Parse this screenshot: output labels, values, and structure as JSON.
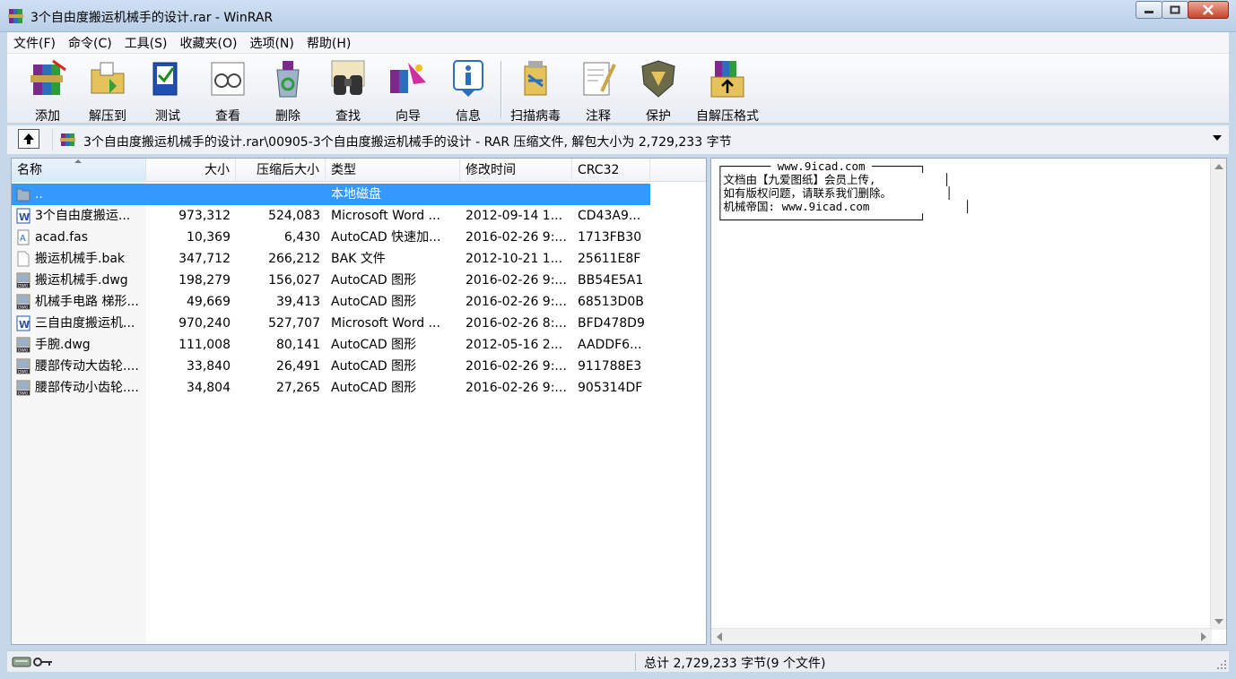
{
  "window": {
    "title": "3个自由度搬运机械手的设计.rar - WinRAR"
  },
  "menu": [
    {
      "label": "文件(F)"
    },
    {
      "label": "命令(C)"
    },
    {
      "label": "工具(S)"
    },
    {
      "label": "收藏夹(O)"
    },
    {
      "label": "选项(N)"
    },
    {
      "label": "帮助(H)"
    }
  ],
  "toolbar": [
    {
      "label": "添加",
      "icon": "add-books-icon"
    },
    {
      "label": "解压到",
      "icon": "extract-folder-icon"
    },
    {
      "label": "测试",
      "icon": "test-check-icon"
    },
    {
      "label": "查看",
      "icon": "view-glasses-icon"
    },
    {
      "label": "删除",
      "icon": "delete-recycle-icon"
    },
    {
      "label": "查找",
      "icon": "find-binoculars-icon"
    },
    {
      "label": "向导",
      "icon": "wizard-icon"
    },
    {
      "label": "信息",
      "icon": "info-icon"
    },
    {
      "label": "扫描病毒",
      "icon": "virus-scan-icon"
    },
    {
      "label": "注释",
      "icon": "comment-pen-icon"
    },
    {
      "label": "保护",
      "icon": "protect-shield-icon"
    },
    {
      "label": "自解压格式",
      "icon": "sfx-box-icon"
    }
  ],
  "address": {
    "path": "3个自由度搬运机械手的设计.rar\\00905-3个自由度搬运机械手的设计 - RAR 压缩文件, 解包大小为 2,729,233 字节"
  },
  "columns": {
    "name": "名称",
    "size": "大小",
    "packed": "压缩后大小",
    "type": "类型",
    "modified": "修改时间",
    "crc": "CRC32"
  },
  "files": [
    {
      "icon": "folder-up-icon",
      "name": "..",
      "size": "",
      "packed": "",
      "type": "本地磁盘",
      "modified": "",
      "crc": "",
      "selected": true
    },
    {
      "icon": "word-doc-icon",
      "name": "3个自由度搬运...",
      "size": "973,312",
      "packed": "524,083",
      "type": "Microsoft Word ...",
      "modified": "2012-09-14 1...",
      "crc": "CD43A9...",
      "selected": false
    },
    {
      "icon": "fas-file-icon",
      "name": "acad.fas",
      "size": "10,369",
      "packed": "6,430",
      "type": "AutoCAD 快速加...",
      "modified": "2016-02-26 9:...",
      "crc": "1713FB30",
      "selected": false
    },
    {
      "icon": "blank-file-icon",
      "name": "搬运机械手.bak",
      "size": "347,712",
      "packed": "266,212",
      "type": "BAK 文件",
      "modified": "2012-10-21 1...",
      "crc": "25611E8F",
      "selected": false
    },
    {
      "icon": "dwg-file-icon",
      "name": "搬运机械手.dwg",
      "size": "198,279",
      "packed": "156,027",
      "type": "AutoCAD 图形",
      "modified": "2016-02-26 9:...",
      "crc": "BB54E5A1",
      "selected": false
    },
    {
      "icon": "dwg-file-icon",
      "name": "机械手电路 梯形...",
      "size": "49,669",
      "packed": "39,413",
      "type": "AutoCAD 图形",
      "modified": "2016-02-26 9:...",
      "crc": "68513D0B",
      "selected": false
    },
    {
      "icon": "word-doc-icon",
      "name": "三自由度搬运机...",
      "size": "970,240",
      "packed": "527,707",
      "type": "Microsoft Word ...",
      "modified": "2016-02-26 8:...",
      "crc": "BFD478D9",
      "selected": false
    },
    {
      "icon": "dwg-file-icon",
      "name": "手腕.dwg",
      "size": "111,008",
      "packed": "80,141",
      "type": "AutoCAD 图形",
      "modified": "2012-05-16 2...",
      "crc": "AADDF6...",
      "selected": false
    },
    {
      "icon": "dwg-file-icon",
      "name": "腰部传动大齿轮....",
      "size": "33,840",
      "packed": "26,491",
      "type": "AutoCAD 图形",
      "modified": "2016-02-26 9:...",
      "crc": "911788E3",
      "selected": false
    },
    {
      "icon": "dwg-file-icon",
      "name": "腰部传动小齿轮....",
      "size": "34,804",
      "packed": "27,265",
      "type": "AutoCAD 图形",
      "modified": "2016-02-26 9:...",
      "crc": "905314DF",
      "selected": false
    }
  ],
  "comment": {
    "lines": [
      "┌─────── www.9icad.com ───────┐",
      "│文档由【九爱图纸】会员上传,          │",
      "│如有版权问题，请联系我们删除。        │",
      "│机械帝国: www.9icad.com              │",
      "└─────────────────────────────┘"
    ]
  },
  "status": {
    "summary": "总计 2,729,233 字节(9 个文件)"
  },
  "colors": {
    "selection": "#3399ff",
    "titlebar": "#b9cfe8"
  }
}
